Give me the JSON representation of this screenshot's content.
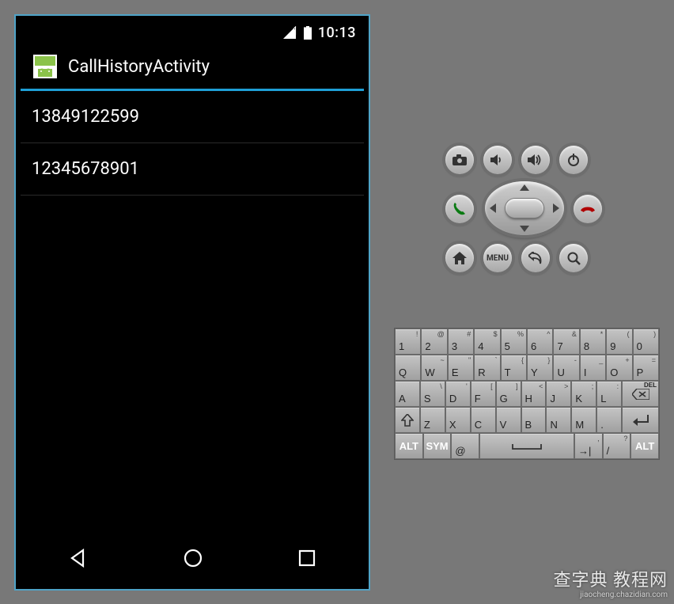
{
  "statusbar": {
    "time": "10:13"
  },
  "actionbar": {
    "title": "CallHistoryActivity"
  },
  "list": {
    "items": [
      "13849122599",
      "12345678901"
    ]
  },
  "watermark": {
    "line1": "查字典 教程网",
    "line2": "jiaocheng.chazidian.com"
  },
  "controls": {
    "row1": [
      "camera",
      "volume-down",
      "volume-up",
      "power"
    ],
    "row2_left": "call",
    "row2_right": "end-call",
    "row3": [
      "home",
      "menu",
      "back",
      "search"
    ],
    "menu_label": "MENU"
  },
  "keyboard": {
    "row1": [
      {
        "m": "1",
        "s": "!"
      },
      {
        "m": "2",
        "s": "@"
      },
      {
        "m": "3",
        "s": "#"
      },
      {
        "m": "4",
        "s": "$"
      },
      {
        "m": "5",
        "s": "%"
      },
      {
        "m": "6",
        "s": "^"
      },
      {
        "m": "7",
        "s": "&"
      },
      {
        "m": "8",
        "s": "*"
      },
      {
        "m": "9",
        "s": "("
      },
      {
        "m": "0",
        "s": ")"
      }
    ],
    "row2": [
      {
        "m": "Q",
        "s": ""
      },
      {
        "m": "W",
        "s": "~"
      },
      {
        "m": "E",
        "s": "\""
      },
      {
        "m": "R",
        "s": "`"
      },
      {
        "m": "T",
        "s": "{"
      },
      {
        "m": "Y",
        "s": "}"
      },
      {
        "m": "U",
        "s": "-"
      },
      {
        "m": "I",
        "s": "_"
      },
      {
        "m": "O",
        "s": "+"
      },
      {
        "m": "P",
        "s": "="
      }
    ],
    "row3": [
      {
        "m": "A",
        "s": ""
      },
      {
        "m": "S",
        "s": "\\"
      },
      {
        "m": "D",
        "s": "'"
      },
      {
        "m": "F",
        "s": "["
      },
      {
        "m": "G",
        "s": "]"
      },
      {
        "m": "H",
        "s": "<"
      },
      {
        "m": "J",
        "s": ">"
      },
      {
        "m": "K",
        "s": ";"
      },
      {
        "m": "L",
        "s": ":"
      }
    ],
    "row3_del": "DEL",
    "row4": [
      {
        "m": "Z",
        "s": ""
      },
      {
        "m": "X",
        "s": ""
      },
      {
        "m": "C",
        "s": ""
      },
      {
        "m": "V",
        "s": ""
      },
      {
        "m": "B",
        "s": ""
      },
      {
        "m": "N",
        "s": ""
      },
      {
        "m": "M",
        "s": ""
      },
      {
        "m": ".",
        "s": ""
      }
    ],
    "row5": {
      "alt": "ALT",
      "sym": "SYM",
      "at": "@",
      "comma_sup": ",",
      "slash": "/",
      "slash_sup": "?"
    }
  }
}
